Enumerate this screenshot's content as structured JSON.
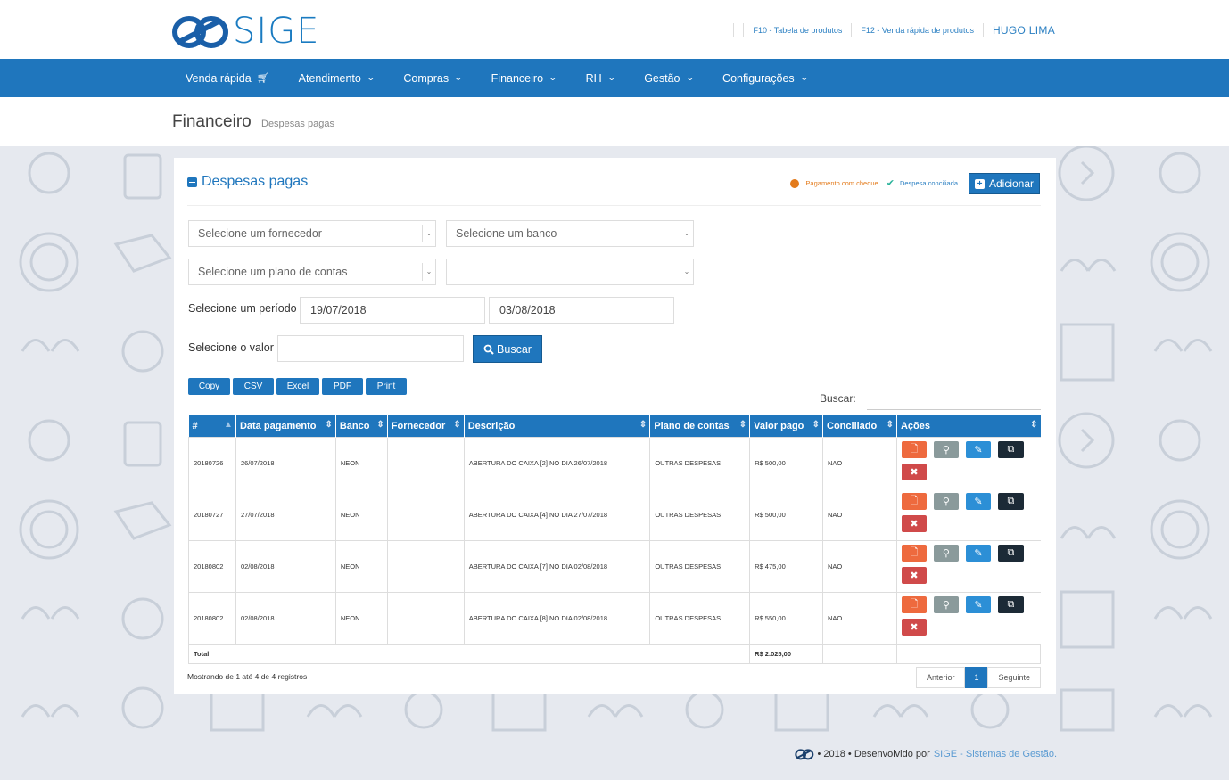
{
  "brand": {
    "name": "SIGE",
    "color": "#1f76bd"
  },
  "toplinks": {
    "f10": "F10 - Tabela de produtos",
    "f12": "F12 - Venda rápida de produtos",
    "user": "HUGO LIMA"
  },
  "nav": {
    "items": [
      "Venda rápida",
      "Atendimento",
      "Compras",
      "Financeiro",
      "RH",
      "Gestão",
      "Configurações"
    ]
  },
  "page": {
    "title": "Financeiro",
    "subtitle": "Despesas pagas"
  },
  "panel": {
    "title": "Despesas pagas",
    "legend_cheque": "Pagamento com cheque",
    "legend_conciliada": "Despesa conciliada",
    "add_label": "Adicionar"
  },
  "filters": {
    "fornecedor_placeholder": "Selecione um fornecedor",
    "banco_placeholder": "Selecione um banco",
    "plano_placeholder": "Selecione um plano de contas",
    "extra_select_value": "",
    "periodo_label": "Selecione um período",
    "date_start": "19/07/2018",
    "date_end": "03/08/2018",
    "valor_label": "Selecione o valor",
    "valor_value": "",
    "buscar_label": "Buscar"
  },
  "export_buttons": [
    "Copy",
    "CSV",
    "Excel",
    "PDF",
    "Print"
  ],
  "search": {
    "label": "Buscar:",
    "value": ""
  },
  "table": {
    "columns": [
      "#",
      "Data pagamento",
      "Banco",
      "Fornecedor",
      "Descrição",
      "Plano de contas",
      "Valor pago",
      "Conciliado",
      "Ações"
    ],
    "rows": [
      [
        "20180726",
        "26/07/2018",
        "NEON",
        "",
        "ABERTURA DO CAIXA [2] NO DIA 26/07/2018",
        "OUTRAS DESPESAS",
        "R$ 500,00",
        "NAO"
      ],
      [
        "20180727",
        "27/07/2018",
        "NEON",
        "",
        "ABERTURA DO CAIXA [4] NO DIA 27/07/2018",
        "OUTRAS DESPESAS",
        "R$ 500,00",
        "NAO"
      ],
      [
        "20180802",
        "02/08/2018",
        "NEON",
        "",
        "ABERTURA DO CAIXA [7] NO DIA 02/08/2018",
        "OUTRAS DESPESAS",
        "R$ 475,00",
        "NAO"
      ],
      [
        "20180802",
        "02/08/2018",
        "NEON",
        "",
        "ABERTURA DO CAIXA [8] NO DIA 02/08/2018",
        "OUTRAS DESPESAS",
        "R$ 550,00",
        "NAO"
      ]
    ],
    "total_label": "Total",
    "total_value": "R$ 2.025,00",
    "action_icons": [
      "file-icon",
      "search-icon",
      "pencil-icon",
      "copy-icon",
      "delete-icon"
    ]
  },
  "pagination": {
    "info": "Mostrando de 1 até 4 de 4 registros",
    "prev": "Anterior",
    "current": "1",
    "next": "Seguinte"
  },
  "footer": {
    "text": "• 2018 • Desenvolvido por",
    "link": "SIGE - Sistemas de Gestão."
  }
}
